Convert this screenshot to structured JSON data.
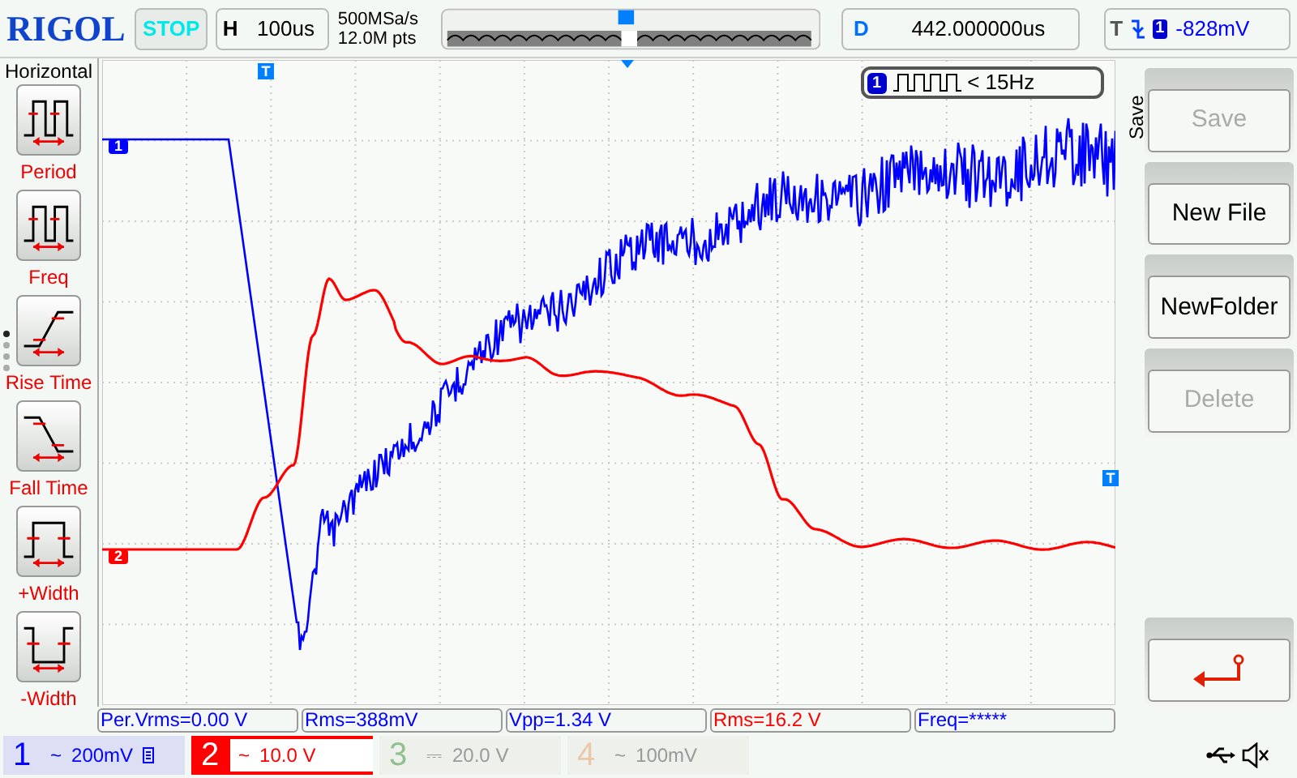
{
  "top_bar": {
    "brand": "RIGOL",
    "run_state": "STOP",
    "timebase": {
      "label": "H",
      "value": "100us"
    },
    "sampling": {
      "rate": "500MSa/s",
      "depth": "12.0M pts"
    },
    "delay": {
      "label": "D",
      "value": "442.000000us"
    },
    "trigger": {
      "label": "T",
      "source": "1",
      "level": "-828mV"
    }
  },
  "left_menu": {
    "title": "Horizontal",
    "items": [
      {
        "kind": "period",
        "label": "Period"
      },
      {
        "kind": "freq",
        "label": "Freq"
      },
      {
        "kind": "rise",
        "label": "Rise Time"
      },
      {
        "kind": "fall",
        "label": "Fall Time"
      },
      {
        "kind": "pwidth",
        "label": "+Width"
      },
      {
        "kind": "nwidth",
        "label": "-Width"
      }
    ],
    "pages": [
      {
        "selected": true
      },
      {
        "selected": false
      },
      {
        "selected": false
      },
      {
        "selected": false
      }
    ]
  },
  "graph": {
    "markers": [
      {
        "kind": "channel",
        "label": "1",
        "color": "#0000ff"
      },
      {
        "kind": "channel",
        "label": "2",
        "color": "#ff0000"
      },
      {
        "kind": "trigger_level",
        "label": "T",
        "color": "#0080ff"
      },
      {
        "kind": "trigger_pos",
        "label": "T",
        "color": "#0080ff"
      }
    ],
    "freq_badge": {
      "channel": "1",
      "text": "< 15Hz"
    }
  },
  "right_menu": {
    "title": "Save",
    "buttons": [
      {
        "kind": "text",
        "label": "Save",
        "disabled": true
      },
      {
        "kind": "text",
        "label": "New File",
        "disabled": false
      },
      {
        "kind": "text",
        "label": "NewFolder",
        "disabled": false
      },
      {
        "kind": "text",
        "label": "Delete",
        "disabled": true
      },
      {
        "kind": "back"
      }
    ]
  },
  "measurements": [
    {
      "text": "Per.Vrms=0.00 V",
      "color": "#0000ff"
    },
    {
      "text": "Rms=388mV",
      "color": "#0000ff"
    },
    {
      "text": "Vpp=1.34 V",
      "color": "#0000ff"
    },
    {
      "text": "Rms=16.2 V",
      "color": "#ff0000"
    },
    {
      "text": "Freq=*****",
      "color": "#0000ff"
    }
  ],
  "channels": [
    {
      "number": "1",
      "coupling": "~",
      "scale": "200mV",
      "on": true,
      "selected": false,
      "bw_limit": true,
      "color": "#0000ff"
    },
    {
      "number": "2",
      "coupling": "~",
      "scale": "10.0 V",
      "on": true,
      "selected": true,
      "bw_limit": false,
      "color": "#ff0000"
    },
    {
      "number": "3",
      "coupling": "⎓",
      "scale": "20.0 V",
      "on": false,
      "selected": false,
      "bw_limit": false,
      "color": "#90c090"
    },
    {
      "number": "4",
      "coupling": "~",
      "scale": "100mV",
      "on": false,
      "selected": false,
      "bw_limit": false,
      "color": "#e8c8a8"
    }
  ]
}
